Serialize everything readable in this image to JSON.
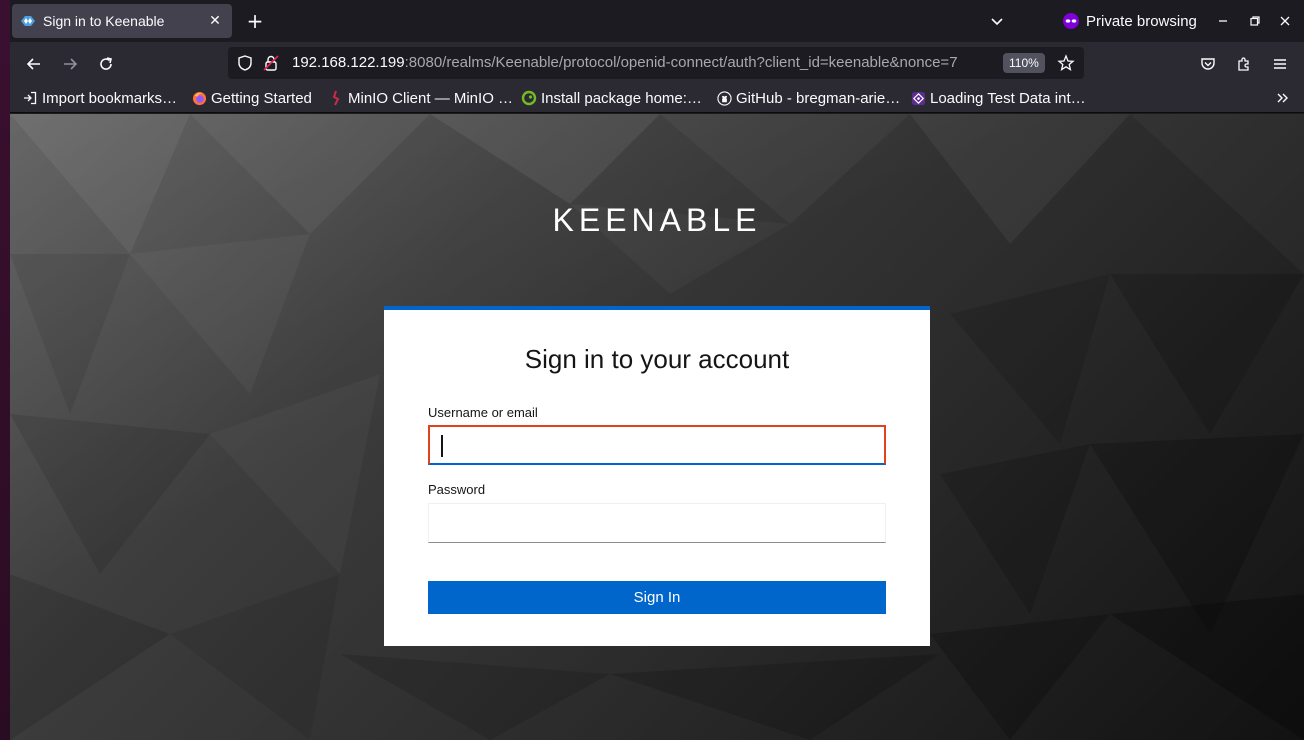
{
  "browser": {
    "tab": {
      "title": "Sign in to Keenable",
      "close_label": "✕"
    },
    "new_tab_label": "+",
    "private_label": "Private browsing",
    "url": {
      "host": "192.168.122.199",
      "rest": ":8080/realms/Keenable/protocol/openid-connect/auth?client_id=keenable&nonce=7"
    },
    "zoom": "110%",
    "bookmarks": [
      {
        "label": "Import bookmarks…",
        "icon": "import-icon"
      },
      {
        "label": "Getting Started",
        "icon": "firefox-icon"
      },
      {
        "label": "MinIO Client — MinIO …",
        "icon": "minio-icon"
      },
      {
        "label": "Install package home:…",
        "icon": "opensuse-icon"
      },
      {
        "label": "GitHub - bregman-arie…",
        "icon": "github-icon"
      },
      {
        "label": "Loading Test Data int…",
        "icon": "opensearch-icon"
      }
    ]
  },
  "page": {
    "brand": "KEENABLE",
    "card_title": "Sign in to your account",
    "username_label": "Username or email",
    "username_value": "",
    "password_label": "Password",
    "password_value": "",
    "sign_in_label": "Sign In"
  },
  "colors": {
    "accent": "#0066cc",
    "focus_border": "#e0431c",
    "private_purple": "#8000d7"
  }
}
